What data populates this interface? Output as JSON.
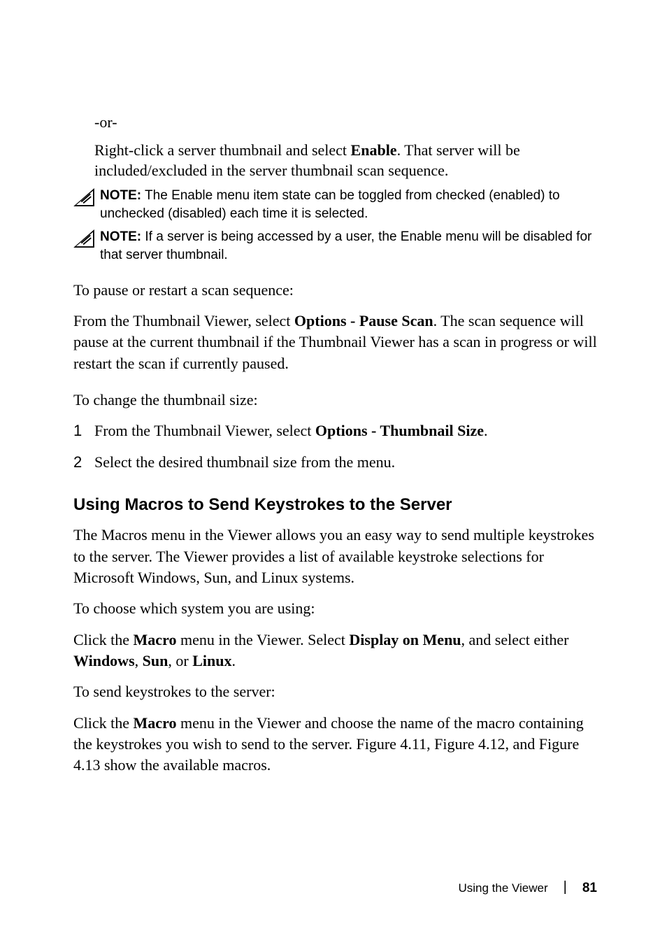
{
  "orText": "-or-",
  "rightClickPara_a": "Right-click a server thumbnail and select ",
  "rightClickPara_enable": "Enable",
  "rightClickPara_b": ". That server will be included/excluded in the server thumbnail scan sequence.",
  "notes": {
    "label": "NOTE:",
    "n1": " The Enable menu item state can be toggled from checked (enabled) to unchecked (disabled) each time it is selected.",
    "n2": " If a server is being accessed by a user, the Enable menu will be disabled for that server thumbnail."
  },
  "pausePara": "To pause or restart a scan sequence:",
  "fromPara_a": "From the Thumbnail Viewer, select ",
  "fromPara_bold": "Options - Pause Scan",
  "fromPara_b": ". The scan sequence will pause at the current thumbnail if the Thumbnail Viewer has a scan in progress or will restart the scan if currently paused.",
  "changeSize": "To change the thumbnail size:",
  "list": {
    "n1": "1",
    "t1a": "From the Thumbnail Viewer, select ",
    "t1b": "Options - Thumbnail Size",
    "t1c": ".",
    "n2": "2",
    "t2": "Select the desired thumbnail size from the menu."
  },
  "heading": "Using Macros to Send Keystrokes to the Server",
  "macrosPara": "The Macros menu in the Viewer allows you an easy way to send multiple keystrokes to the server. The Viewer provides a list of available keystroke selections for Microsoft Windows, Sun, and Linux systems.",
  "choosePara": "To choose which system you are using:",
  "clickMacro1_a": "Click the ",
  "clickMacro1_macro": "Macro",
  "clickMacro1_b": " menu in the Viewer. Select ",
  "clickMacro1_display": "Display on Menu",
  "clickMacro1_c": ", and select either ",
  "clickMacro1_win": "Windows",
  "clickMacro1_comma1": ", ",
  "clickMacro1_sun": "Sun",
  "clickMacro1_comma2": ", or ",
  "clickMacro1_linux": "Linux",
  "clickMacro1_d": ".",
  "sendKeys": "To send keystrokes to the server:",
  "clickMacro2_a": "Click the ",
  "clickMacro2_macro": "Macro",
  "clickMacro2_b": " menu in the Viewer and choose the name of the macro containing the keystrokes you wish to send to the server. Figure 4.11, Figure 4.12, and Figure 4.13 show the available macros.",
  "footer": {
    "title": "Using the Viewer",
    "page": "81"
  }
}
